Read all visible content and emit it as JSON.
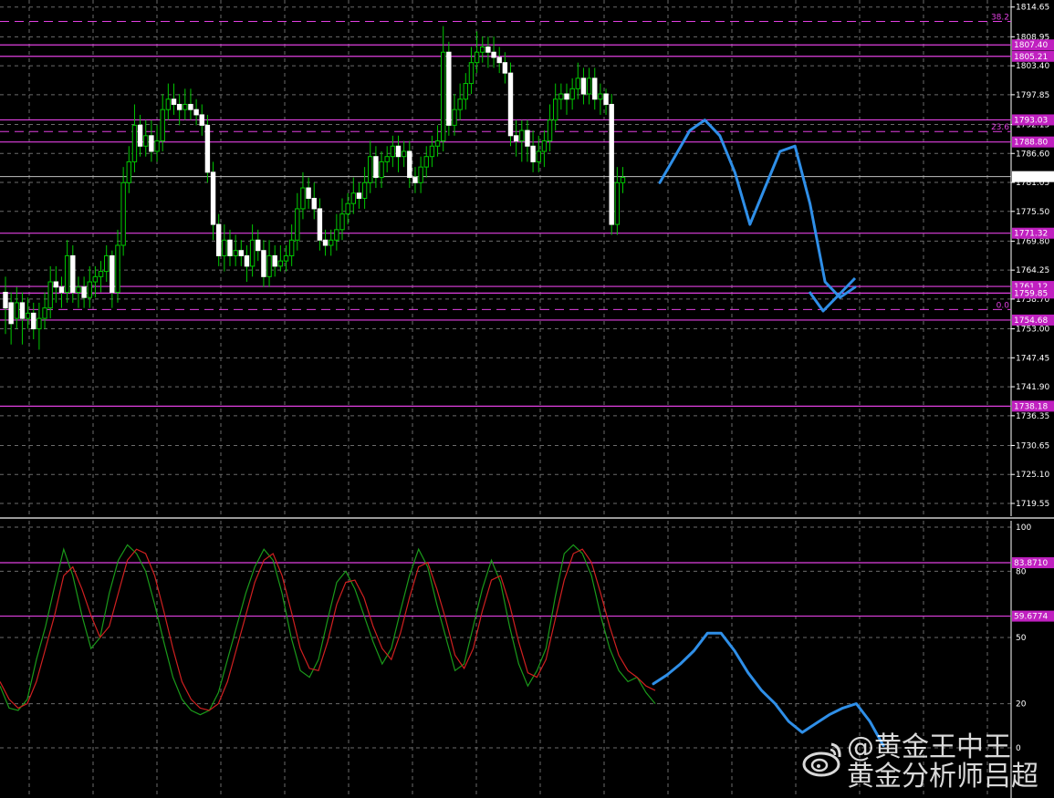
{
  "chart_data": [
    {
      "type": "candlestick",
      "title": "",
      "y_ticks": [
        "1814.65",
        "1808.95",
        "1803.40",
        "1797.85",
        "1792.15",
        "1786.60",
        "1781.05",
        "1775.50",
        "1769.80",
        "1764.25",
        "1758.70",
        "1753.00",
        "1747.45",
        "1741.90",
        "1736.35",
        "1730.65",
        "1725.10",
        "1719.55"
      ],
      "ylim": [
        1717.8,
        1816.0
      ],
      "price_line": 1782.16,
      "level_tags": [
        "1807.40",
        "1805.21",
        "1793.03",
        "1788.80",
        "1771.32",
        "1761.12",
        "1759.85",
        "1754.68",
        "1738.18"
      ],
      "fib_labels": [
        {
          "label": "38.2",
          "value": 1811.9
        },
        {
          "label": "23.6",
          "value": 1790.8
        },
        {
          "label": "0.0",
          "value": 1756.7
        }
      ],
      "candles": [
        [
          1760,
          1757,
          1763,
          1752
        ],
        [
          1758,
          1754,
          1760,
          1750
        ],
        [
          1755,
          1758,
          1761,
          1753
        ],
        [
          1758,
          1755,
          1760,
          1750
        ],
        [
          1755,
          1756,
          1759,
          1753
        ],
        [
          1756,
          1753,
          1758,
          1751
        ],
        [
          1753,
          1755,
          1758,
          1749
        ],
        [
          1755,
          1757,
          1760,
          1753
        ],
        [
          1757,
          1762,
          1765,
          1755
        ],
        [
          1762,
          1761,
          1765,
          1758
        ],
        [
          1761,
          1760,
          1763,
          1757
        ],
        [
          1760,
          1767,
          1770,
          1758
        ],
        [
          1767,
          1760,
          1769,
          1758
        ],
        [
          1760,
          1761,
          1763,
          1757
        ],
        [
          1761,
          1759,
          1763,
          1757
        ],
        [
          1759,
          1762,
          1765,
          1757
        ],
        [
          1762,
          1763,
          1765,
          1759
        ],
        [
          1763,
          1764,
          1766,
          1760
        ],
        [
          1764,
          1767,
          1769,
          1762
        ],
        [
          1767,
          1760,
          1768,
          1757
        ],
        [
          1760,
          1769,
          1772,
          1758
        ],
        [
          1769,
          1781,
          1784,
          1767
        ],
        [
          1781,
          1785,
          1788,
          1779
        ],
        [
          1785,
          1792,
          1796,
          1783
        ],
        [
          1792,
          1788,
          1794,
          1786
        ],
        [
          1788,
          1790,
          1793,
          1786
        ],
        [
          1790,
          1787,
          1793,
          1785
        ],
        [
          1787,
          1789,
          1792,
          1785
        ],
        [
          1789,
          1795,
          1798,
          1787
        ],
        [
          1795,
          1797,
          1800,
          1793
        ],
        [
          1797,
          1796,
          1800,
          1794
        ],
        [
          1796,
          1795,
          1798,
          1792
        ],
        [
          1795,
          1796,
          1799,
          1793
        ],
        [
          1796,
          1795,
          1799,
          1793
        ],
        [
          1795,
          1794,
          1797,
          1792
        ],
        [
          1794,
          1792,
          1796,
          1790
        ],
        [
          1792,
          1783,
          1794,
          1781
        ],
        [
          1783,
          1773,
          1785,
          1770
        ],
        [
          1773,
          1767,
          1775,
          1765
        ],
        [
          1767,
          1770,
          1773,
          1764
        ],
        [
          1770,
          1767,
          1772,
          1765
        ],
        [
          1767,
          1768,
          1771,
          1765
        ],
        [
          1768,
          1767,
          1770,
          1765
        ],
        [
          1767,
          1765,
          1769,
          1762
        ],
        [
          1765,
          1770,
          1773,
          1763
        ],
        [
          1770,
          1768,
          1772,
          1766
        ],
        [
          1768,
          1763,
          1770,
          1761
        ],
        [
          1763,
          1767,
          1770,
          1761
        ],
        [
          1767,
          1765,
          1769,
          1763
        ],
        [
          1765,
          1766,
          1769,
          1764
        ],
        [
          1766,
          1767,
          1769,
          1764
        ],
        [
          1767,
          1770,
          1773,
          1765
        ],
        [
          1770,
          1776,
          1779,
          1768
        ],
        [
          1776,
          1780,
          1783,
          1774
        ],
        [
          1780,
          1778,
          1782,
          1776
        ],
        [
          1778,
          1776,
          1781,
          1774
        ],
        [
          1776,
          1770,
          1778,
          1768
        ],
        [
          1770,
          1769,
          1772,
          1767
        ],
        [
          1769,
          1770,
          1772,
          1767
        ],
        [
          1770,
          1772,
          1775,
          1768
        ],
        [
          1772,
          1775,
          1778,
          1770
        ],
        [
          1775,
          1777,
          1779,
          1773
        ],
        [
          1777,
          1779,
          1782,
          1775
        ],
        [
          1779,
          1778,
          1781,
          1776
        ],
        [
          1778,
          1781,
          1784,
          1776
        ],
        [
          1781,
          1786,
          1789,
          1779
        ],
        [
          1786,
          1782,
          1788,
          1780
        ],
        [
          1782,
          1785,
          1787,
          1780
        ],
        [
          1785,
          1786,
          1788,
          1783
        ],
        [
          1786,
          1788,
          1790,
          1784
        ],
        [
          1788,
          1786,
          1790,
          1783
        ],
        [
          1786,
          1787,
          1789,
          1784
        ],
        [
          1787,
          1782,
          1789,
          1780
        ],
        [
          1782,
          1781,
          1784,
          1779
        ],
        [
          1781,
          1784,
          1786,
          1779
        ],
        [
          1784,
          1786,
          1788,
          1782
        ],
        [
          1786,
          1788,
          1790,
          1784
        ],
        [
          1788,
          1789,
          1792,
          1786
        ],
        [
          1789,
          1806,
          1811,
          1787
        ],
        [
          1806,
          1792,
          1808,
          1790
        ],
        [
          1792,
          1795,
          1798,
          1790
        ],
        [
          1795,
          1797,
          1800,
          1793
        ],
        [
          1797,
          1800,
          1802,
          1795
        ],
        [
          1800,
          1804,
          1807,
          1798
        ],
        [
          1804,
          1806,
          1810,
          1802
        ],
        [
          1806,
          1807,
          1809,
          1804
        ],
        [
          1807,
          1806,
          1809,
          1803
        ],
        [
          1806,
          1805,
          1809,
          1803
        ],
        [
          1805,
          1804,
          1807,
          1802
        ],
        [
          1804,
          1802,
          1806,
          1800
        ],
        [
          1802,
          1790,
          1804,
          1788
        ],
        [
          1790,
          1789,
          1793,
          1786
        ],
        [
          1789,
          1791,
          1793,
          1785
        ],
        [
          1791,
          1788,
          1793,
          1785
        ],
        [
          1788,
          1785,
          1791,
          1783
        ],
        [
          1785,
          1787,
          1790,
          1783
        ],
        [
          1787,
          1789,
          1791,
          1784
        ],
        [
          1789,
          1793,
          1796,
          1787
        ],
        [
          1793,
          1797,
          1800,
          1791
        ],
        [
          1797,
          1798,
          1800,
          1795
        ],
        [
          1798,
          1797,
          1800,
          1794
        ],
        [
          1797,
          1799,
          1801,
          1795
        ],
        [
          1799,
          1801,
          1804,
          1797
        ],
        [
          1801,
          1798,
          1803,
          1796
        ],
        [
          1798,
          1801,
          1803,
          1796
        ],
        [
          1801,
          1797,
          1803,
          1795
        ],
        [
          1797,
          1798,
          1800,
          1794
        ],
        [
          1798,
          1796,
          1799,
          1794
        ],
        [
          1796,
          1773,
          1798,
          1771
        ],
        [
          1773,
          1781,
          1784,
          1771
        ],
        [
          1781,
          1782,
          1784,
          1779
        ]
      ],
      "projection_main": [
        1781,
        1786,
        1791,
        1793,
        1790,
        1783,
        1773,
        1780,
        1787,
        1788,
        1777,
        1762,
        1759,
        1761
      ]
    },
    {
      "type": "line",
      "title": "",
      "y_ticks": [
        "100",
        "80",
        "50",
        "20",
        "0"
      ],
      "ylim": [
        0,
        100
      ],
      "level_tags": [
        "83.8710",
        "59.6774"
      ],
      "series_green": [
        28,
        18,
        17,
        22,
        40,
        55,
        73,
        90,
        78,
        60,
        45,
        50,
        70,
        85,
        92,
        88,
        80,
        65,
        48,
        32,
        22,
        17,
        15,
        17,
        25,
        40,
        55,
        70,
        82,
        90,
        85,
        70,
        50,
        35,
        32,
        40,
        58,
        75,
        80,
        72,
        60,
        48,
        38,
        45,
        62,
        78,
        90,
        82,
        65,
        50,
        35,
        38,
        55,
        72,
        85,
        75,
        55,
        38,
        28,
        35,
        45,
        68,
        88,
        92,
        88,
        78,
        60,
        45,
        35,
        30,
        32,
        25,
        20
      ],
      "series_red": [
        30,
        22,
        18,
        20,
        30,
        45,
        60,
        78,
        82,
        72,
        60,
        50,
        55,
        70,
        85,
        90,
        88,
        78,
        62,
        45,
        30,
        22,
        18,
        17,
        20,
        30,
        45,
        60,
        75,
        85,
        88,
        78,
        62,
        45,
        36,
        35,
        48,
        65,
        75,
        76,
        68,
        55,
        45,
        40,
        52,
        68,
        82,
        84,
        72,
        58,
        42,
        36,
        45,
        62,
        76,
        78,
        65,
        48,
        34,
        32,
        40,
        58,
        76,
        88,
        90,
        84,
        70,
        55,
        42,
        35,
        32,
        28,
        26
      ],
      "projection_osc": [
        29,
        33,
        38,
        44,
        52,
        52,
        44,
        34,
        26,
        20,
        12,
        7,
        11,
        15,
        18,
        20,
        12,
        1
      ]
    }
  ],
  "watermark": {
    "line1": "@黄金王中王",
    "line2": "黄金分析师吕超",
    "logo_icon": "weibo-logo"
  },
  "colors": {
    "bull": "#00c800",
    "bear": "#ffffff",
    "magenta": "#e040e0",
    "grid": "#6b6b6b",
    "osc_green": "#1a9a1a",
    "osc_red": "#d02020",
    "projection": "#2f8fe8"
  }
}
